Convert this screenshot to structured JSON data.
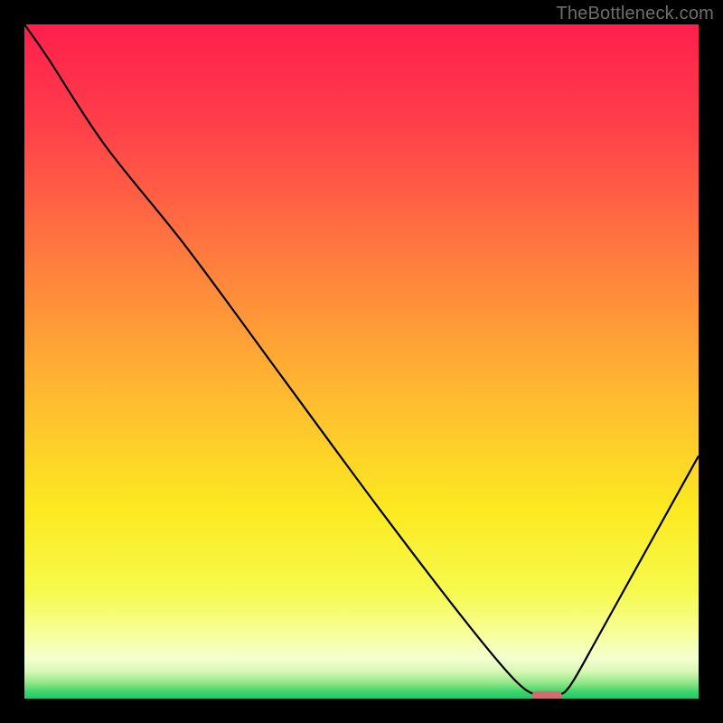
{
  "watermark": "TheBottleneck.com",
  "chart_data": {
    "type": "line",
    "title": "",
    "xlabel": "",
    "ylabel": "",
    "xlim": [
      0,
      100
    ],
    "ylim": [
      0,
      100
    ],
    "grid": false,
    "series": [
      {
        "name": "curve",
        "x": [
          0,
          3.5,
          12,
          24,
          38,
          52,
          65,
          72.5,
          76,
          79,
          81,
          85,
          90,
          95,
          100
        ],
        "y": [
          100,
          95,
          82,
          67,
          48,
          29,
          12,
          3,
          0.5,
          0.5,
          2,
          9,
          18,
          27,
          36
        ]
      }
    ],
    "marker": {
      "x": 77.5,
      "y": 0.4,
      "color": "#d36d6d",
      "width_pct": 4.5,
      "height_pct": 1.4,
      "rx_pct": 0.7
    },
    "background_gradient": {
      "stops": [
        {
          "offset": 0.0,
          "color": "#ff1f4c"
        },
        {
          "offset": 0.15,
          "color": "#ff3f4a"
        },
        {
          "offset": 0.35,
          "color": "#ff7d3e"
        },
        {
          "offset": 0.55,
          "color": "#ffba30"
        },
        {
          "offset": 0.72,
          "color": "#fcea21"
        },
        {
          "offset": 0.84,
          "color": "#f6fa4c"
        },
        {
          "offset": 0.905,
          "color": "#f7ff9b"
        },
        {
          "offset": 0.94,
          "color": "#f4ffd0"
        },
        {
          "offset": 0.96,
          "color": "#d7f8b5"
        },
        {
          "offset": 0.978,
          "color": "#8be584"
        },
        {
          "offset": 0.99,
          "color": "#3ed36d"
        },
        {
          "offset": 1.0,
          "color": "#1fc96a"
        }
      ]
    }
  }
}
